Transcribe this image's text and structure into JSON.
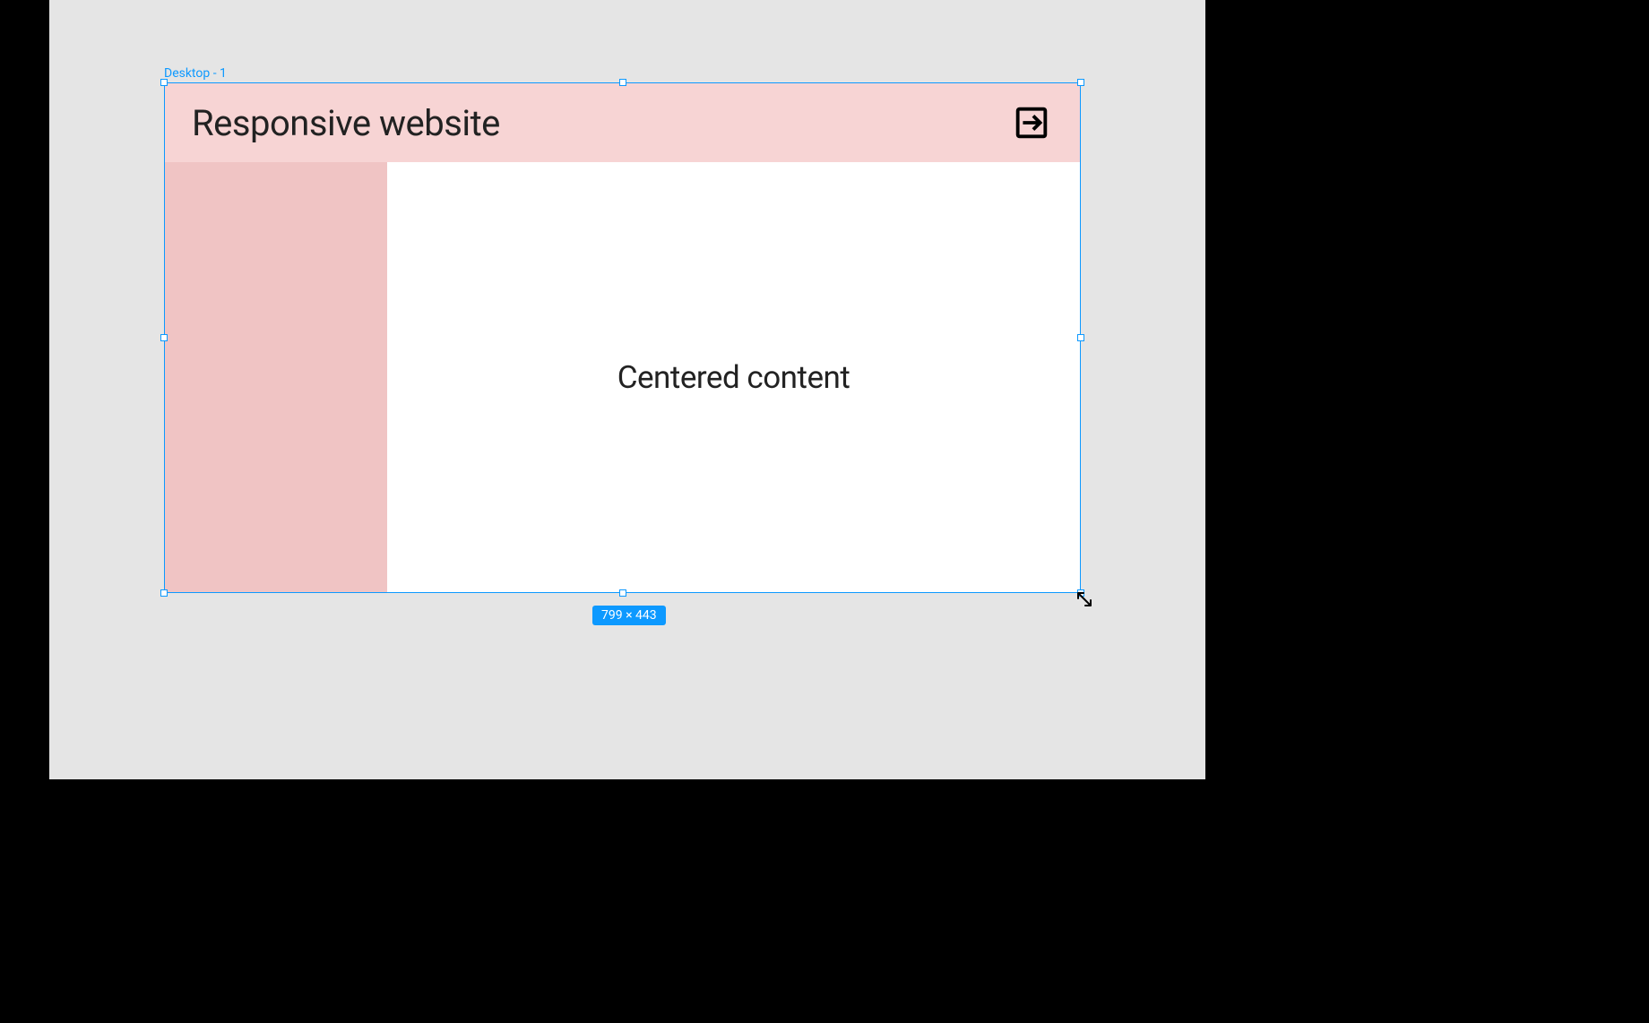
{
  "canvas": {
    "frame_label": "Desktop - 1",
    "dimensions_badge": "799 × 443",
    "frame_content": {
      "header_title": "Responsive website",
      "main_text": "Centered content"
    }
  }
}
